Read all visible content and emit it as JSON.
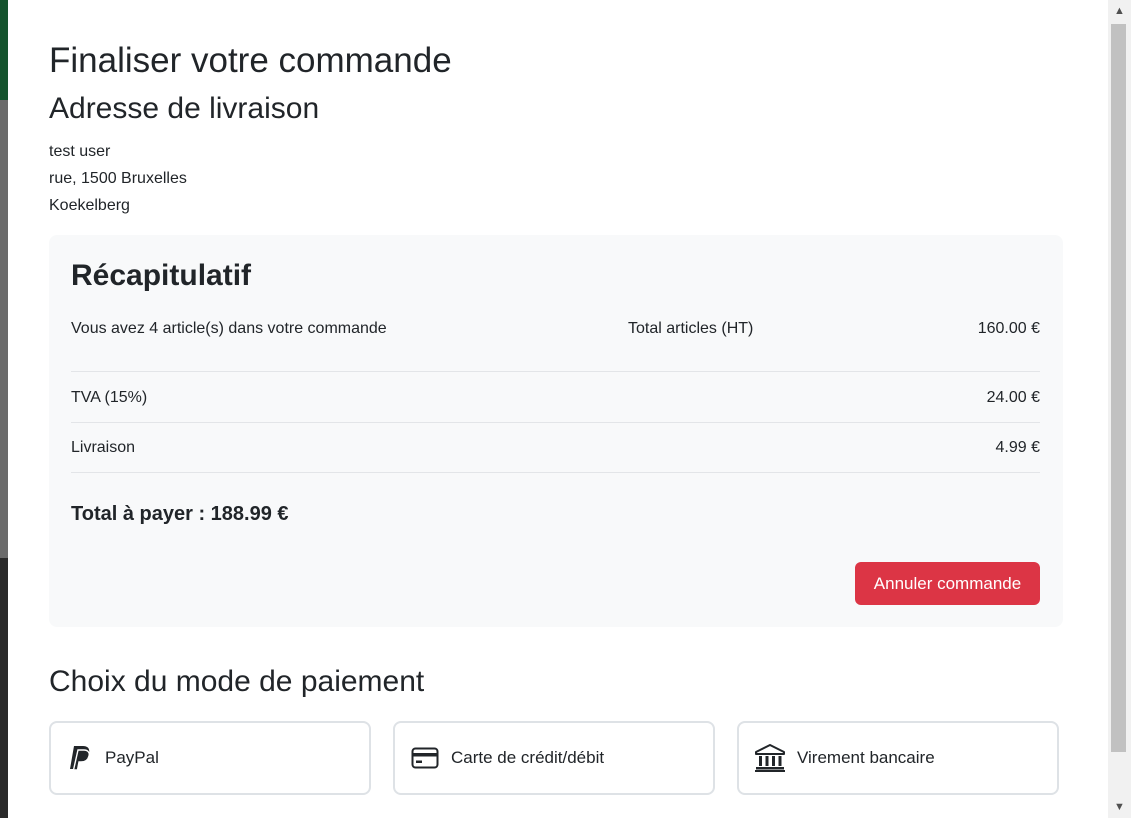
{
  "page": {
    "title": "Finaliser votre commande"
  },
  "address": {
    "title": "Adresse de livraison",
    "lines": [
      "test user",
      "rue, 1500 Bruxelles",
      "Koekelberg"
    ]
  },
  "summary": {
    "title": "Récapitulatif",
    "items_text": "Vous avez 4 article(s) dans votre commande",
    "subtotal_label": "Total articles (HT)",
    "subtotal_value": "160.00 €",
    "tax_label": "TVA (15%)",
    "tax_value": "24.00 €",
    "shipping_label": "Livraison",
    "shipping_value": "4.99 €",
    "total_text": "Total à payer : 188.99 €",
    "cancel_label": "Annuler commande"
  },
  "payment": {
    "title": "Choix du mode de paiement",
    "methods": [
      {
        "label": "PayPal",
        "icon": "paypal-icon"
      },
      {
        "label": "Carte de crédit/débit",
        "icon": "credit-card-icon"
      },
      {
        "label": "Virement bancaire",
        "icon": "bank-icon"
      }
    ]
  },
  "colors": {
    "danger": "#dc3545",
    "panel_bg": "#f8f9fa",
    "text": "#212529"
  }
}
